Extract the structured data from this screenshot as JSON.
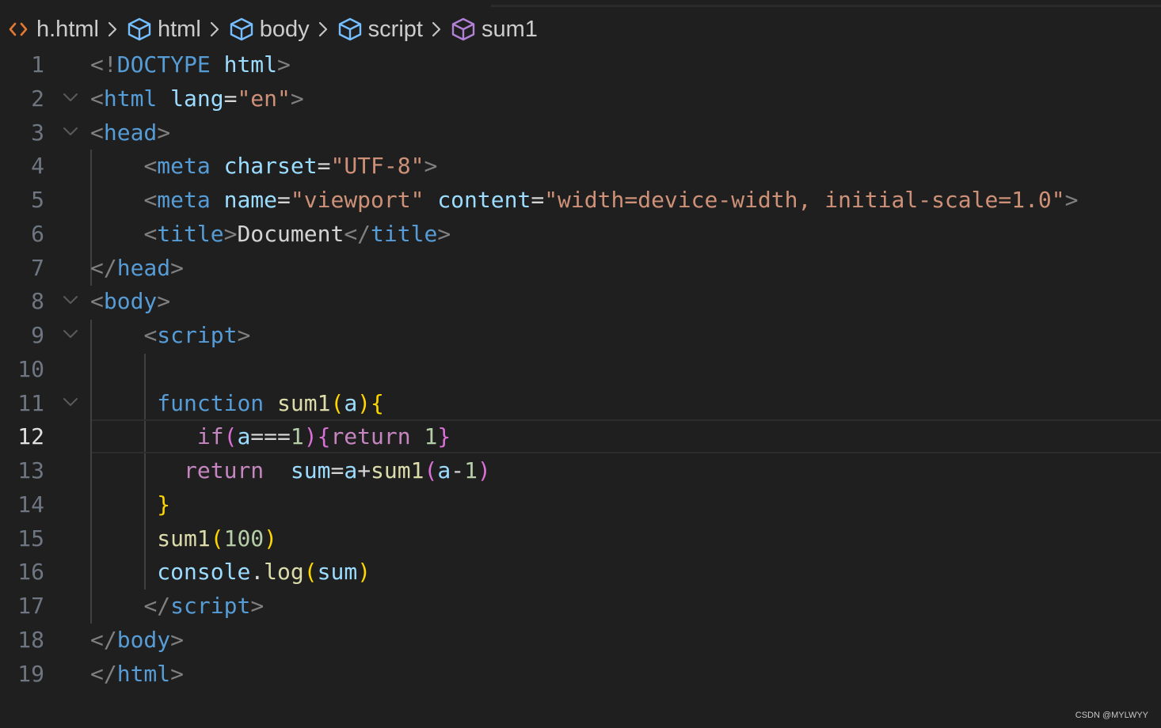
{
  "breadcrumb": {
    "items": [
      {
        "label": "h.html",
        "icon": "html-file-icon",
        "color": "#e37933"
      },
      {
        "label": "html",
        "icon": "element-cube-icon",
        "color": "#75beff"
      },
      {
        "label": "body",
        "icon": "element-cube-icon",
        "color": "#75beff"
      },
      {
        "label": "script",
        "icon": "element-cube-icon",
        "color": "#75beff"
      },
      {
        "label": "sum1",
        "icon": "function-cube-icon",
        "color": "#b180d7"
      }
    ],
    "separator_icon": "chevron-right-icon"
  },
  "editor": {
    "current_line": 12,
    "lines": [
      {
        "n": "1",
        "fold": false,
        "tokens": [
          [
            "t-punc",
            "<!"
          ],
          [
            "t-tag",
            "DOCTYPE"
          ],
          [
            "t-text",
            " "
          ],
          [
            "t-attr",
            "html"
          ],
          [
            "t-punc",
            ">"
          ]
        ]
      },
      {
        "n": "2",
        "fold": true,
        "tokens": [
          [
            "t-punc",
            "<"
          ],
          [
            "t-tag",
            "html"
          ],
          [
            "t-text",
            " "
          ],
          [
            "t-attr",
            "lang"
          ],
          [
            "t-text",
            "="
          ],
          [
            "t-str",
            "\"en\""
          ],
          [
            "t-punc",
            ">"
          ]
        ]
      },
      {
        "n": "3",
        "fold": true,
        "tokens": [
          [
            "t-punc",
            "<"
          ],
          [
            "t-tag",
            "head"
          ],
          [
            "t-punc",
            ">"
          ]
        ]
      },
      {
        "n": "4",
        "fold": false,
        "tokens": [
          [
            "t-text",
            "    "
          ],
          [
            "t-punc",
            "<"
          ],
          [
            "t-tag",
            "meta"
          ],
          [
            "t-text",
            " "
          ],
          [
            "t-attr",
            "charset"
          ],
          [
            "t-text",
            "="
          ],
          [
            "t-str",
            "\"UTF-8\""
          ],
          [
            "t-punc",
            ">"
          ]
        ]
      },
      {
        "n": "5",
        "fold": false,
        "tokens": [
          [
            "t-text",
            "    "
          ],
          [
            "t-punc",
            "<"
          ],
          [
            "t-tag",
            "meta"
          ],
          [
            "t-text",
            " "
          ],
          [
            "t-attr",
            "name"
          ],
          [
            "t-text",
            "="
          ],
          [
            "t-str",
            "\"viewport\""
          ],
          [
            "t-text",
            " "
          ],
          [
            "t-attr",
            "content"
          ],
          [
            "t-text",
            "="
          ],
          [
            "t-str",
            "\"width=device-width, initial-scale=1.0\""
          ],
          [
            "t-punc",
            ">"
          ]
        ]
      },
      {
        "n": "6",
        "fold": false,
        "tokens": [
          [
            "t-text",
            "    "
          ],
          [
            "t-punc",
            "<"
          ],
          [
            "t-tag",
            "title"
          ],
          [
            "t-punc",
            ">"
          ],
          [
            "t-text",
            "Document"
          ],
          [
            "t-punc",
            "</"
          ],
          [
            "t-tag",
            "title"
          ],
          [
            "t-punc",
            ">"
          ]
        ]
      },
      {
        "n": "7",
        "fold": false,
        "tokens": [
          [
            "t-punc",
            "</"
          ],
          [
            "t-tag",
            "head"
          ],
          [
            "t-punc",
            ">"
          ]
        ]
      },
      {
        "n": "8",
        "fold": true,
        "tokens": [
          [
            "t-punc",
            "<"
          ],
          [
            "t-tag",
            "body"
          ],
          [
            "t-punc",
            ">"
          ]
        ]
      },
      {
        "n": "9",
        "fold": true,
        "tokens": [
          [
            "t-text",
            "    "
          ],
          [
            "t-punc",
            "<"
          ],
          [
            "t-tag",
            "script"
          ],
          [
            "t-punc",
            ">"
          ]
        ]
      },
      {
        "n": "10",
        "fold": false,
        "tokens": []
      },
      {
        "n": "11",
        "fold": true,
        "tokens": [
          [
            "t-text",
            "     "
          ],
          [
            "t-kw",
            "function"
          ],
          [
            "t-text",
            " "
          ],
          [
            "t-func",
            "sum1"
          ],
          [
            "t-br1",
            "("
          ],
          [
            "t-var",
            "a"
          ],
          [
            "t-br1",
            ")"
          ],
          [
            "t-br1",
            "{"
          ]
        ]
      },
      {
        "n": "12",
        "fold": false,
        "tokens": [
          [
            "t-text",
            "        "
          ],
          [
            "t-ctrl",
            "if"
          ],
          [
            "t-br2",
            "("
          ],
          [
            "t-var",
            "a"
          ],
          [
            "t-op",
            "==="
          ],
          [
            "t-num",
            "1"
          ],
          [
            "t-br2",
            ")"
          ],
          [
            "t-br2",
            "{"
          ],
          [
            "t-ctrl",
            "return"
          ],
          [
            "t-text",
            " "
          ],
          [
            "t-num",
            "1"
          ],
          [
            "t-br2",
            "}"
          ]
        ]
      },
      {
        "n": "13",
        "fold": false,
        "tokens": [
          [
            "t-text",
            "       "
          ],
          [
            "t-ctrl",
            "return"
          ],
          [
            "t-text",
            "  "
          ],
          [
            "t-var",
            "sum"
          ],
          [
            "t-op",
            "="
          ],
          [
            "t-var",
            "a"
          ],
          [
            "t-op",
            "+"
          ],
          [
            "t-func",
            "sum1"
          ],
          [
            "t-br2",
            "("
          ],
          [
            "t-var",
            "a"
          ],
          [
            "t-op",
            "-"
          ],
          [
            "t-num",
            "1"
          ],
          [
            "t-br2",
            ")"
          ]
        ]
      },
      {
        "n": "14",
        "fold": false,
        "tokens": [
          [
            "t-text",
            "     "
          ],
          [
            "t-br1",
            "}"
          ]
        ]
      },
      {
        "n": "15",
        "fold": false,
        "tokens": [
          [
            "t-text",
            "     "
          ],
          [
            "t-func",
            "sum1"
          ],
          [
            "t-br1",
            "("
          ],
          [
            "t-num",
            "100"
          ],
          [
            "t-br1",
            ")"
          ]
        ]
      },
      {
        "n": "16",
        "fold": false,
        "tokens": [
          [
            "t-text",
            "     "
          ],
          [
            "t-var",
            "console"
          ],
          [
            "t-op",
            "."
          ],
          [
            "t-func",
            "log"
          ],
          [
            "t-br1",
            "("
          ],
          [
            "t-var",
            "sum"
          ],
          [
            "t-br1",
            ")"
          ]
        ]
      },
      {
        "n": "17",
        "fold": false,
        "tokens": [
          [
            "t-text",
            "    "
          ],
          [
            "t-punc",
            "</"
          ],
          [
            "t-tag",
            "script"
          ],
          [
            "t-punc",
            ">"
          ]
        ]
      },
      {
        "n": "18",
        "fold": false,
        "tokens": [
          [
            "t-punc",
            "</"
          ],
          [
            "t-tag",
            "body"
          ],
          [
            "t-punc",
            ">"
          ]
        ]
      },
      {
        "n": "19",
        "fold": false,
        "tokens": [
          [
            "t-punc",
            "</"
          ],
          [
            "t-tag",
            "html"
          ],
          [
            "t-punc",
            ">"
          ]
        ]
      }
    ]
  },
  "watermark": "CSDN @MYLWYY"
}
